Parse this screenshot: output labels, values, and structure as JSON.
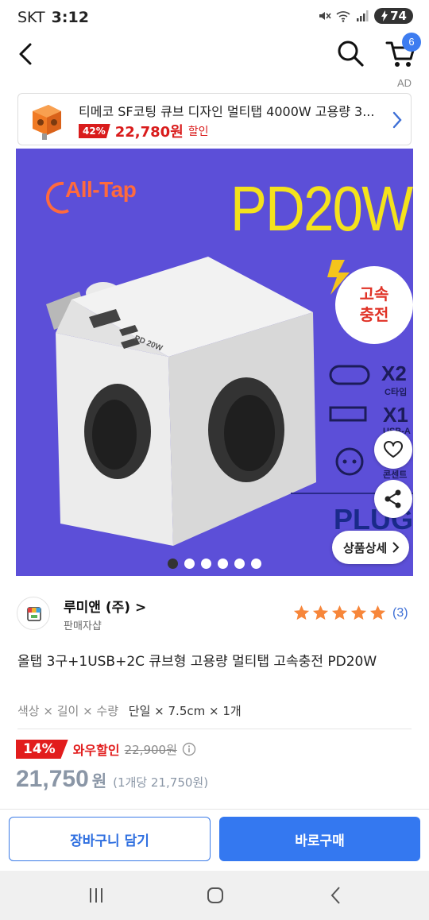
{
  "status_bar": {
    "carrier": "SKT",
    "time": "3:12",
    "battery": "74"
  },
  "header": {
    "cart_count": "6"
  },
  "ad": {
    "label": "AD",
    "title": "티메코 SF코팅 큐브 디자인 멀티탭 4000W 고용량 3...",
    "discount": "42%",
    "price": "22,780원",
    "sale_text": "할인"
  },
  "image": {
    "brand": "All-Tap",
    "headline": "PD20W",
    "badge_line1": "고속",
    "badge_line2": "충전",
    "feature1_count": "X2",
    "feature1_label": "C타입",
    "feature2_count": "X1",
    "feature2_label": "USB-A",
    "feature3_label": "콘센트",
    "plug_text": "PLUG",
    "device_label": "PD 20W",
    "carousel_total": 6,
    "carousel_active": 0,
    "detail_button": "상품상세"
  },
  "seller": {
    "name": "루미앤 (주)",
    "type": "판매자샵",
    "rating": 5,
    "review_count": "(3)"
  },
  "product": {
    "title": "올탭 3구+1USB+2C 큐브형 고용량 멀티탭 고속충전 PD20W",
    "option_label": "색상 × 길이 × 수량",
    "option_value": "단일 × 7.5cm × 1개"
  },
  "pricing": {
    "discount": "14%",
    "wow_label": "와우할인",
    "original_price": "22,900원",
    "final_price": "21,750",
    "currency": "원",
    "unit_price": "(1개당 21,750원)"
  },
  "actions": {
    "add_to_cart": "장바구니 담기",
    "buy_now": "바로구매"
  },
  "colors": {
    "accent": "#3478f0",
    "sale_red": "#e21d1d",
    "image_bg": "#5c4fd8",
    "headline": "#f4e21c",
    "star": "#f7863a"
  }
}
